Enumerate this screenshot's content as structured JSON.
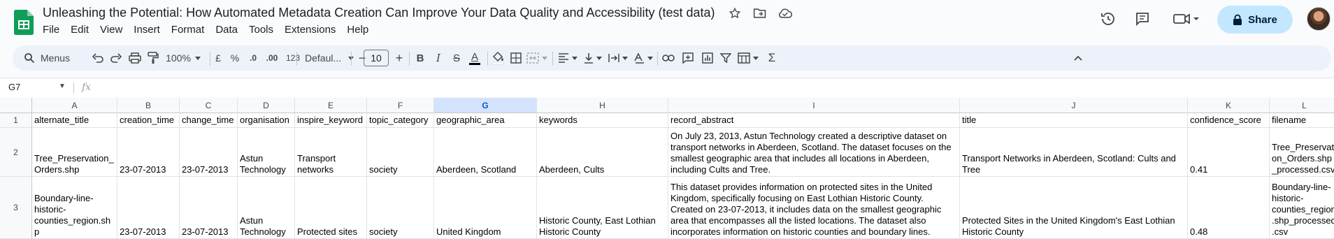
{
  "app": {
    "title": "Unleashing the Potential: How Automated Metadata Creation Can Improve Your Data Quality and Accessibility (test data)",
    "menu": [
      "File",
      "Edit",
      "View",
      "Insert",
      "Format",
      "Data",
      "Tools",
      "Extensions",
      "Help"
    ],
    "share_label": "Share"
  },
  "toolbar": {
    "search_label": "Menus",
    "zoom": "100%",
    "currency": "£",
    "percent": "%",
    "dec_decrease": ".0",
    "dec_increase": ".00",
    "format_123": "123",
    "font": "Defaul...",
    "font_size": "10",
    "bold": "B",
    "italic": "I",
    "strike": "S",
    "text_color_glyph": "A"
  },
  "formula_bar": {
    "cell_ref": "G7",
    "fx": "fx"
  },
  "columns": [
    "A",
    "B",
    "C",
    "D",
    "E",
    "F",
    "G",
    "H",
    "I",
    "J",
    "K",
    "L"
  ],
  "selected_column": "G",
  "rows": [
    {
      "num": "1",
      "cells": [
        "alternate_title",
        "creation_time",
        "change_time",
        "organisation",
        "inspire_keyword",
        "topic_category",
        "geographic_area",
        "keywords",
        "record_abstract",
        "title",
        "confidence_score",
        "filename"
      ]
    },
    {
      "num": "2",
      "cells": [
        "Tree_Preservation_Orders.shp",
        "23-07-2013",
        "23-07-2013",
        "Astun Technology",
        "Transport networks",
        "society",
        "Aberdeen, Scotland",
        "Aberdeen, Cults",
        "On July 23, 2013, Astun Technology created a descriptive dataset on transport networks in Aberdeen, Scotland. The dataset focuses on the smallest geographic area that includes all locations in Aberdeen, including Cults and Tree.",
        "Transport Networks in Aberdeen, Scotland: Cults and Tree",
        "0.41",
        "Tree_Preservation_Orders.shp_processed.csv"
      ]
    },
    {
      "num": "3",
      "cells": [
        "Boundary-line-historic-counties_region.shp",
        "23-07-2013",
        "23-07-2013",
        "Astun Technology",
        "Protected sites",
        "society",
        "United Kingdom",
        "Historic County, East Lothian Historic County",
        "This dataset provides information on protected sites in the United Kingdom, specifically focusing on East Lothian Historic County. Created on 23-07-2013, it includes data on the smallest geographic area that encompasses all the listed locations. The dataset also incorporates information on historic counties and boundary lines.",
        "Protected Sites in the United Kingdom's East Lothian Historic County",
        "0.48",
        "Boundary-line-historic-counties_region.shp_processed.csv"
      ]
    }
  ]
}
